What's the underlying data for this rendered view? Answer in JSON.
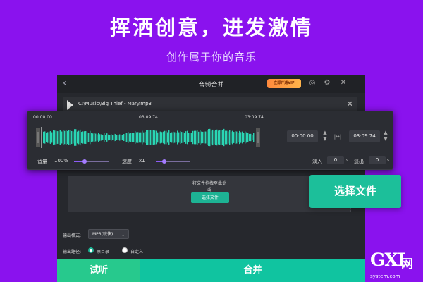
{
  "hero": {
    "title": "挥洒创意，进发激情",
    "subtitle": "创作属于你的音乐"
  },
  "app": {
    "title": "音频合并",
    "vip_badge": "立即开通VIP",
    "back_icon": "chevron-left-icon",
    "window_icons": [
      "user-icon",
      "gear-icon",
      "close-icon"
    ]
  },
  "file": {
    "path": "C:\\Music\\Big Thief - Mary.mp3",
    "play_icon": "play-icon",
    "close_icon": "close-icon"
  },
  "timeline": {
    "mark_start": "00:00.00",
    "mark_mid": "03:09.74",
    "mark_end": "03:09.74",
    "start_time": "00:00.00",
    "end_time": "03:09.74"
  },
  "controls": {
    "volume_label": "音量",
    "volume_value": "100%",
    "volume_level": 0.3,
    "speed_label": "速度",
    "speed_value": "x1",
    "speed_level": 0.25,
    "fade_in_label": "淡入",
    "fade_in_value": "0",
    "fade_out_label": "淡出",
    "fade_out_value": "0",
    "unit": "s"
  },
  "drop": {
    "text_line1": "将文件拖拽至此处",
    "text_line2": "或",
    "button_label": "选择文件"
  },
  "callout": {
    "select_file_label": "选择文件"
  },
  "output": {
    "format_label": "输出格式:",
    "format_value": "MP3(较快)",
    "path_label": "输出路径:",
    "path_option_1": "原目录",
    "path_option_2": "自定义",
    "selected_option": "原目录"
  },
  "actions": {
    "listen_label": "试听",
    "merge_label": "合并"
  },
  "watermark": {
    "brand": "GXI",
    "brand_net": "网",
    "url": "system.com"
  },
  "colors": {
    "background": "#8a12ee",
    "accent_green": "#1db394",
    "wave": "#2ad6b4"
  }
}
